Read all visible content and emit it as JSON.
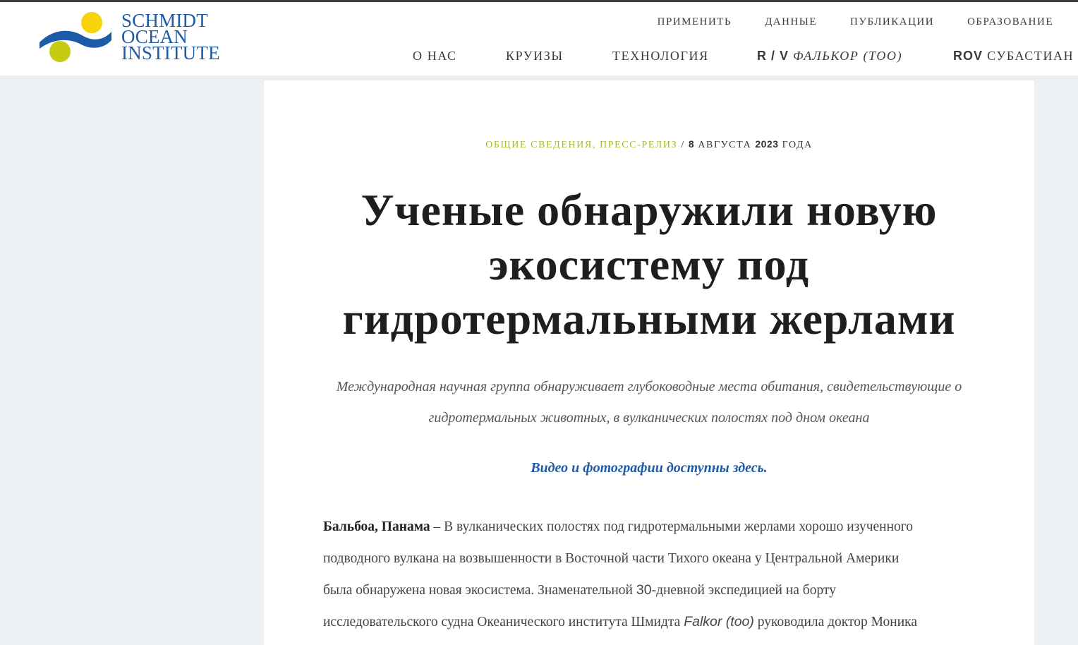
{
  "logo": {
    "line1": "SCHMIDT",
    "line2": "OCEAN",
    "line3": "INSTITUTE",
    "colors": {
      "sun": "#f9d30a",
      "ball": "#c6cc14",
      "wave": "#1d5aa8"
    }
  },
  "nav_top": [
    "ПРИМЕНИТЬ",
    "ДАННЫЕ",
    "ПУБЛИКАЦИИ",
    "ОБРАЗОВАНИЕ"
  ],
  "nav_main": {
    "about": "О НАС",
    "cruises": "КРУИЗЫ",
    "technology": "ТЕХНОЛОГИЯ",
    "falkor_prefix": "R / V",
    "falkor_name": "ФАЛЬКОР (TOO)",
    "rov_prefix": "ROV",
    "rov_name": "СУБАСТИАН"
  },
  "article": {
    "categories": "ОБЩИЕ СВЕДЕНИЯ, ПРЕСС-РЕЛИЗ",
    "separator": " / ",
    "date_day": "8",
    "date_month": " АВГУСТА ",
    "date_year": "2023",
    "date_suffix": " ГОДА",
    "title": "Ученые обнаружили новую экосистему под гидротермальными жерлами",
    "subtitle": "Международная научная группа обнаруживает глубоководные места обитания, свидетельствующие о гидротермальных животных, в вулканических полостях под дном океана",
    "media_link": "Видео и фотографии доступны здесь",
    "media_link_punct": ".",
    "dateline": "Бальбоа, Панама",
    "body_l1": " – В вулканических полостях под гидротермальными жерлами хорошо изученного",
    "body_l2": "подводного вулкана на возвышенности в Восточной части Тихого океана у Центральной Америки",
    "body_l3a": "была обнаружена новая экосистема. Знаменательной ",
    "body_l3b": "30",
    "body_l3c": "-дневной экспедицией на борту",
    "body_l4a": "исследовательского судна Океанического института Шмидта ",
    "body_l4b": "Falkor (too)",
    "body_l4c": " руководила доктор Моника"
  }
}
